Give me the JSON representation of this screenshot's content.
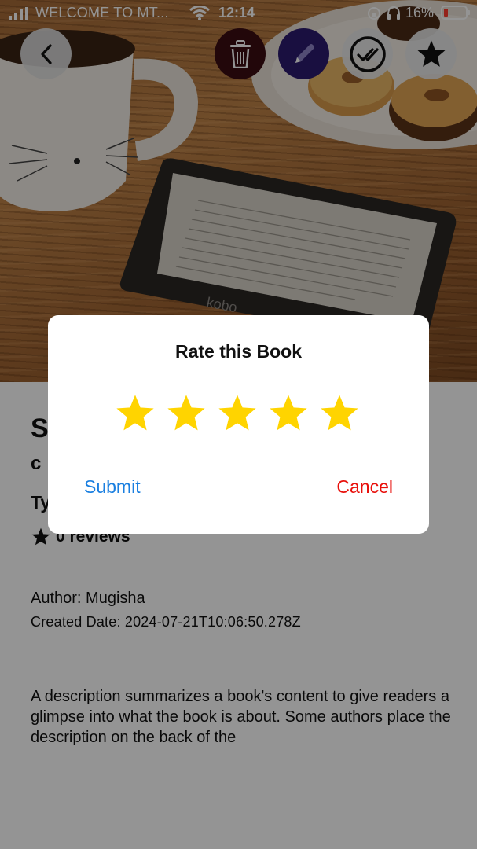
{
  "status_bar": {
    "carrier": "WELCOME TO MT...",
    "time": "12:14",
    "battery": "16%"
  },
  "icons": {
    "back": "chevron-left-icon",
    "delete": "trash-icon",
    "edit": "pencil-icon",
    "complete": "double-check-icon",
    "favorite": "star-icon"
  },
  "colors": {
    "star": "#ffd400",
    "submit": "#1a7fe0",
    "cancel": "#e8100b",
    "delete_button": "#3b0d12",
    "edit_button": "#2c1a6e"
  },
  "book": {
    "title_partial": "S",
    "subtitle_partial": "c",
    "type_partial": "Ty",
    "reviews": "0 reviews",
    "author": "Author: Mugisha",
    "created": "Created Date: 2024-07-21T10:06:50.278Z",
    "description": "A description summarizes a book's content to give readers a glimpse into what the book is about. Some authors place the description on the back of the"
  },
  "dialog": {
    "title": "Rate this Book",
    "rating": 5,
    "max_rating": 5,
    "submit_label": "Submit",
    "cancel_label": "Cancel"
  }
}
